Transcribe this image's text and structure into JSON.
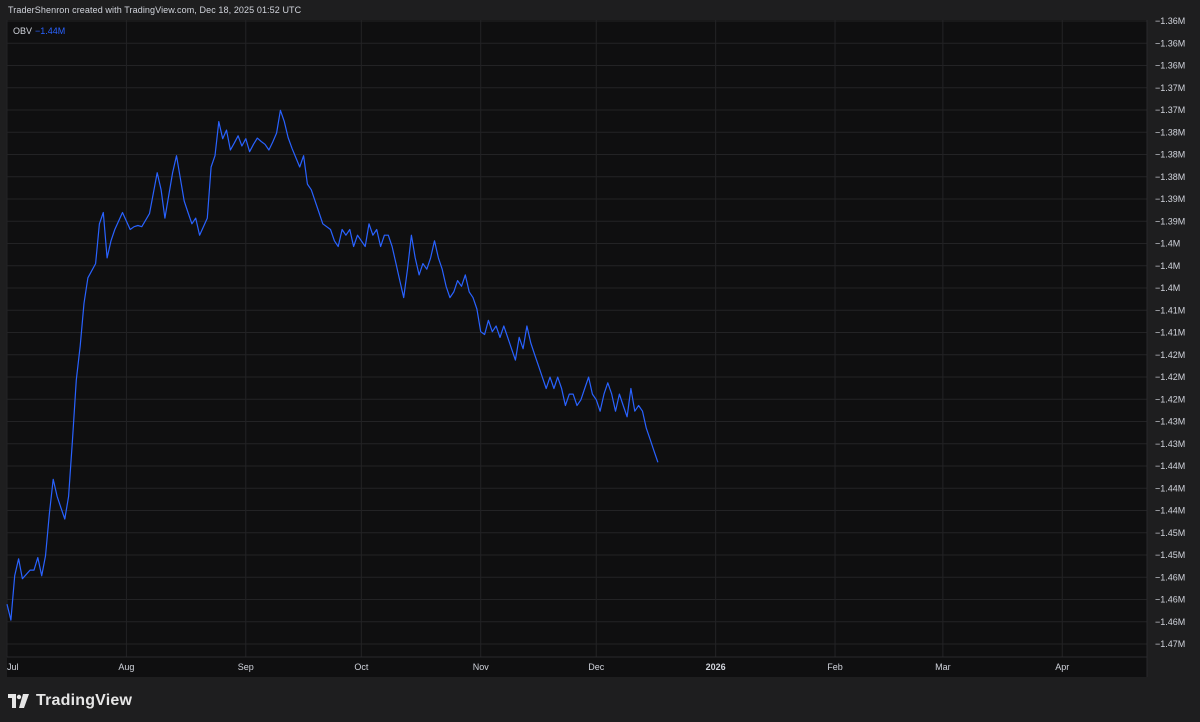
{
  "attribution": "TraderShenron created with TradingView.com, Dec 18, 2025 01:52 UTC",
  "brand": {
    "name": "TradingView",
    "logo_icon": "tradingview-logo-icon"
  },
  "legend": {
    "indicator": "OBV",
    "value": "−1.44M"
  },
  "colors": {
    "background": "#0f0f10",
    "line": "#2962ff",
    "grid": "#232325",
    "text": "#d1d4dc",
    "legend_value": "#2962ff"
  },
  "chart_data": {
    "type": "line",
    "title": "",
    "series": [
      {
        "name": "OBV"
      }
    ],
    "x_tick_labels": [
      "Jul",
      "Aug",
      "Sep",
      "Oct",
      "Nov",
      "Dec",
      "2026",
      "Feb",
      "Mar",
      "Apr"
    ],
    "x_tick_dates": [
      "2025-07-01",
      "2025-08-01",
      "2025-09-01",
      "2025-10-01",
      "2025-11-01",
      "2025-12-01",
      "2026-01-01",
      "2026-02-01",
      "2026-03-01",
      "2026-04-01"
    ],
    "x_range": [
      "2025-07-01",
      "2026-04-23"
    ],
    "y_tick_labels": [
      "−1.36M",
      "−1.36M",
      "−1.36M",
      "−1.37M",
      "−1.37M",
      "−1.38M",
      "−1.38M",
      "−1.38M",
      "−1.39M",
      "−1.39M",
      "−1.4M",
      "−1.4M",
      "−1.4M",
      "−1.41M",
      "−1.41M",
      "−1.42M",
      "−1.42M",
      "−1.42M",
      "−1.43M",
      "−1.43M",
      "−1.44M",
      "−1.44M",
      "−1.44M",
      "−1.45M",
      "−1.45M",
      "−1.46M",
      "−1.46M",
      "−1.46M",
      "−1.47M"
    ],
    "y_range": [
      -1.4703,
      -1.3581
    ],
    "y_unit": "M",
    "grid": true,
    "points": [
      [
        "2025-07-01",
        -1.461
      ],
      [
        "2025-07-02",
        -1.4638
      ],
      [
        "2025-07-03",
        -1.456
      ],
      [
        "2025-07-04",
        -1.453
      ],
      [
        "2025-07-05",
        -1.4565
      ],
      [
        "2025-07-07",
        -1.455
      ],
      [
        "2025-07-08",
        -1.455
      ],
      [
        "2025-07-09",
        -1.4528
      ],
      [
        "2025-07-10",
        -1.456
      ],
      [
        "2025-07-11",
        -1.4525
      ],
      [
        "2025-07-12",
        -1.445
      ],
      [
        "2025-07-13",
        -1.439
      ],
      [
        "2025-07-14",
        -1.442
      ],
      [
        "2025-07-15",
        -1.444
      ],
      [
        "2025-07-16",
        -1.446
      ],
      [
        "2025-07-17",
        -1.442
      ],
      [
        "2025-07-18",
        -1.432
      ],
      [
        "2025-07-19",
        -1.4215
      ],
      [
        "2025-07-20",
        -1.4155
      ],
      [
        "2025-07-21",
        -1.408
      ],
      [
        "2025-07-22",
        -1.4035
      ],
      [
        "2025-07-24",
        -1.401
      ],
      [
        "2025-07-25",
        -1.394
      ],
      [
        "2025-07-26",
        -1.392
      ],
      [
        "2025-07-27",
        -1.4
      ],
      [
        "2025-07-28",
        -1.397
      ],
      [
        "2025-07-29",
        -1.395
      ],
      [
        "2025-07-31",
        -1.392
      ],
      [
        "2025-08-02",
        -1.395
      ],
      [
        "2025-08-03",
        -1.3945
      ],
      [
        "2025-08-04",
        -1.3943
      ],
      [
        "2025-08-05",
        -1.3945
      ],
      [
        "2025-08-07",
        -1.3922
      ],
      [
        "2025-08-09",
        -1.385
      ],
      [
        "2025-08-10",
        -1.388
      ],
      [
        "2025-08-11",
        -1.393
      ],
      [
        "2025-08-13",
        -1.385
      ],
      [
        "2025-08-14",
        -1.382
      ],
      [
        "2025-08-16",
        -1.39
      ],
      [
        "2025-08-17",
        -1.392
      ],
      [
        "2025-08-18",
        -1.394
      ],
      [
        "2025-08-19",
        -1.393
      ],
      [
        "2025-08-20",
        -1.396
      ],
      [
        "2025-08-22",
        -1.393
      ],
      [
        "2025-08-23",
        -1.384
      ],
      [
        "2025-08-24",
        -1.382
      ],
      [
        "2025-08-25",
        -1.376
      ],
      [
        "2025-08-26",
        -1.379
      ],
      [
        "2025-08-27",
        -1.3775
      ],
      [
        "2025-08-28",
        -1.381
      ],
      [
        "2025-08-29",
        -1.3798
      ],
      [
        "2025-08-30",
        -1.3785
      ],
      [
        "2025-08-31",
        -1.3803
      ],
      [
        "2025-09-01",
        -1.379
      ],
      [
        "2025-09-02",
        -1.3813
      ],
      [
        "2025-09-03",
        -1.38
      ],
      [
        "2025-09-04",
        -1.3789
      ],
      [
        "2025-09-05",
        -1.3795
      ],
      [
        "2025-09-06",
        -1.38
      ],
      [
        "2025-09-07",
        -1.381
      ],
      [
        "2025-09-08",
        -1.3796
      ],
      [
        "2025-09-09",
        -1.378
      ],
      [
        "2025-09-10",
        -1.374
      ],
      [
        "2025-09-11",
        -1.376
      ],
      [
        "2025-09-12",
        -1.3788
      ],
      [
        "2025-09-13",
        -1.3807
      ],
      [
        "2025-09-15",
        -1.384
      ],
      [
        "2025-09-16",
        -1.382
      ],
      [
        "2025-09-17",
        -1.387
      ],
      [
        "2025-09-18",
        -1.388
      ],
      [
        "2025-09-19",
        -1.39
      ],
      [
        "2025-09-20",
        -1.392
      ],
      [
        "2025-09-21",
        -1.394
      ],
      [
        "2025-09-23",
        -1.395
      ],
      [
        "2025-09-24",
        -1.397
      ],
      [
        "2025-09-25",
        -1.398
      ],
      [
        "2025-09-26",
        -1.395
      ],
      [
        "2025-09-27",
        -1.396
      ],
      [
        "2025-09-28",
        -1.395
      ],
      [
        "2025-09-29",
        -1.398
      ],
      [
        "2025-09-30",
        -1.396
      ],
      [
        "2025-10-02",
        -1.398
      ],
      [
        "2025-10-03",
        -1.394
      ],
      [
        "2025-10-04",
        -1.396
      ],
      [
        "2025-10-05",
        -1.395
      ],
      [
        "2025-10-06",
        -1.398
      ],
      [
        "2025-10-07",
        -1.396
      ],
      [
        "2025-10-08",
        -1.396
      ],
      [
        "2025-10-09",
        -1.398
      ],
      [
        "2025-10-10",
        -1.401
      ],
      [
        "2025-10-11",
        -1.404
      ],
      [
        "2025-10-12",
        -1.407
      ],
      [
        "2025-10-13",
        -1.402
      ],
      [
        "2025-10-14",
        -1.396
      ],
      [
        "2025-10-15",
        -1.4
      ],
      [
        "2025-10-16",
        -1.403
      ],
      [
        "2025-10-17",
        -1.401
      ],
      [
        "2025-10-18",
        -1.402
      ],
      [
        "2025-10-19",
        -1.4
      ],
      [
        "2025-10-20",
        -1.397
      ],
      [
        "2025-10-21",
        -1.4
      ],
      [
        "2025-10-22",
        -1.402
      ],
      [
        "2025-10-23",
        -1.405
      ],
      [
        "2025-10-24",
        -1.407
      ],
      [
        "2025-10-25",
        -1.406
      ],
      [
        "2025-10-26",
        -1.404
      ],
      [
        "2025-10-27",
        -1.405
      ],
      [
        "2025-10-28",
        -1.403
      ],
      [
        "2025-10-29",
        -1.406
      ],
      [
        "2025-10-30",
        -1.407
      ],
      [
        "2025-10-31",
        -1.409
      ],
      [
        "2025-11-01",
        -1.413
      ],
      [
        "2025-11-02",
        -1.4135
      ],
      [
        "2025-11-03",
        -1.411
      ],
      [
        "2025-11-04",
        -1.413
      ],
      [
        "2025-11-05",
        -1.412
      ],
      [
        "2025-11-06",
        -1.414
      ],
      [
        "2025-11-07",
        -1.412
      ],
      [
        "2025-11-08",
        -1.414
      ],
      [
        "2025-11-09",
        -1.416
      ],
      [
        "2025-11-10",
        -1.418
      ],
      [
        "2025-11-11",
        -1.414
      ],
      [
        "2025-11-12",
        -1.416
      ],
      [
        "2025-11-13",
        -1.412
      ],
      [
        "2025-11-14",
        -1.415
      ],
      [
        "2025-11-15",
        -1.417
      ],
      [
        "2025-11-16",
        -1.419
      ],
      [
        "2025-11-17",
        -1.421
      ],
      [
        "2025-11-18",
        -1.423
      ],
      [
        "2025-11-19",
        -1.421
      ],
      [
        "2025-11-20",
        -1.423
      ],
      [
        "2025-11-21",
        -1.421
      ],
      [
        "2025-11-22",
        -1.423
      ],
      [
        "2025-11-23",
        -1.426
      ],
      [
        "2025-11-24",
        -1.424
      ],
      [
        "2025-11-25",
        -1.424
      ],
      [
        "2025-11-26",
        -1.426
      ],
      [
        "2025-11-27",
        -1.425
      ],
      [
        "2025-11-28",
        -1.423
      ],
      [
        "2025-11-29",
        -1.421
      ],
      [
        "2025-11-30",
        -1.424
      ],
      [
        "2025-12-01",
        -1.425
      ],
      [
        "2025-12-02",
        -1.427
      ],
      [
        "2025-12-03",
        -1.424
      ],
      [
        "2025-12-04",
        -1.422
      ],
      [
        "2025-12-05",
        -1.424
      ],
      [
        "2025-12-06",
        -1.427
      ],
      [
        "2025-12-07",
        -1.424
      ],
      [
        "2025-12-08",
        -1.426
      ],
      [
        "2025-12-09",
        -1.428
      ],
      [
        "2025-12-10",
        -1.423
      ],
      [
        "2025-12-11",
        -1.427
      ],
      [
        "2025-12-12",
        -1.426
      ],
      [
        "2025-12-13",
        -1.427
      ],
      [
        "2025-12-14",
        -1.43
      ],
      [
        "2025-12-15",
        -1.432
      ],
      [
        "2025-12-16",
        -1.434
      ],
      [
        "2025-12-17",
        -1.436
      ]
    ]
  }
}
